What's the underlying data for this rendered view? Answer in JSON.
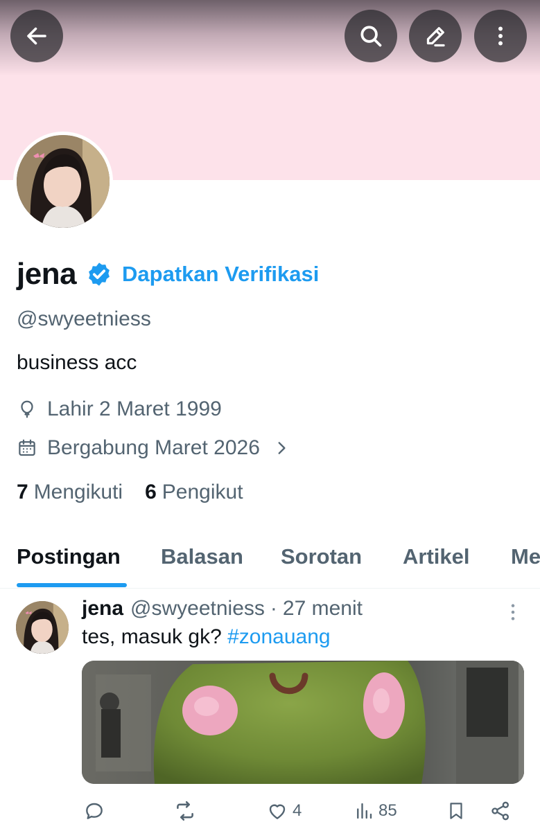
{
  "header": {
    "back_icon": "arrow-left-icon",
    "search_icon": "search-icon",
    "edit_icon": "pencil-icon",
    "more_icon": "vertical-dots-icon"
  },
  "colors": {
    "banner": "#fde2ea",
    "accent": "#1d9bf0",
    "text": "#0f1419",
    "muted": "#536471"
  },
  "profile": {
    "name": "jena",
    "verified_icon": "verified-badge-icon",
    "get_verified_label": "Dapatkan Verifikasi",
    "handle": "@swyeetniess",
    "bio": "business acc",
    "birth": "Lahir 2 Maret 1999",
    "joined": "Bergabung Maret 2026",
    "following_count": "7",
    "following_label": "Mengikuti",
    "followers_count": "6",
    "followers_label": "Pengikut"
  },
  "tabs": [
    {
      "label": "Postingan",
      "active": true
    },
    {
      "label": "Balasan",
      "active": false
    },
    {
      "label": "Sorotan",
      "active": false
    },
    {
      "label": "Artikel",
      "active": false
    },
    {
      "label": "Me",
      "active": false
    }
  ],
  "post": {
    "name": "jena",
    "handle": "@swyeetniess",
    "separator": "·",
    "time": "27 menit",
    "text": "tes, masuk gk? ",
    "hashtag": "#zonauang",
    "stats": {
      "reply": "",
      "repost": "",
      "likes": "4",
      "views": "85"
    }
  }
}
